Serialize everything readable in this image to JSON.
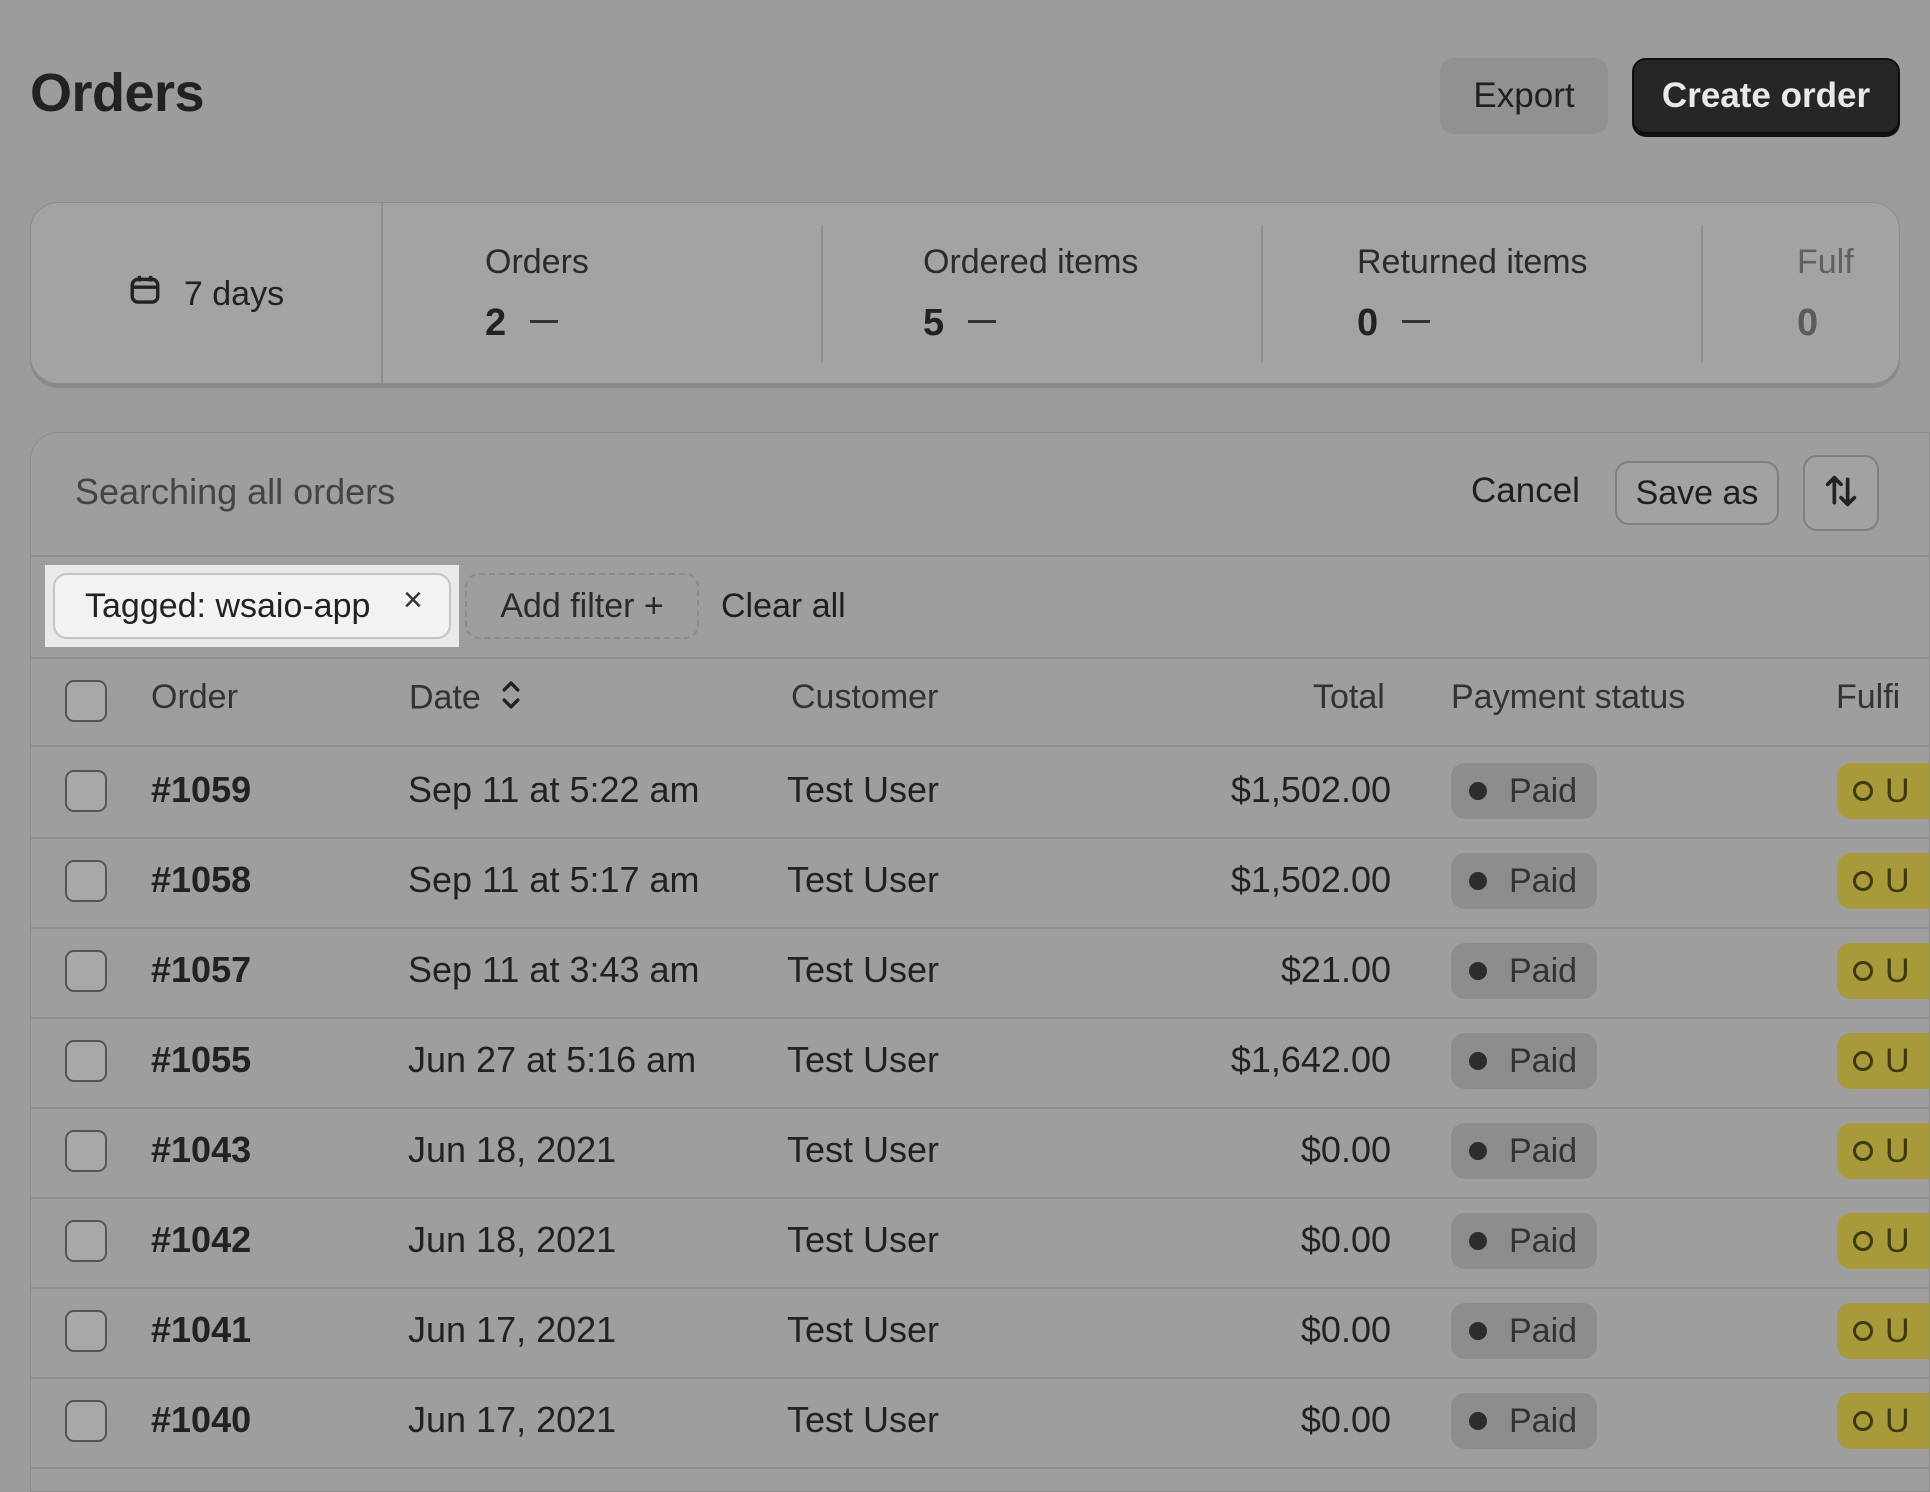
{
  "header": {
    "title": "Orders",
    "export_label": "Export",
    "create_label": "Create order"
  },
  "stats": {
    "period": "7 days",
    "items": [
      {
        "label": "Orders",
        "value": "2"
      },
      {
        "label": "Ordered items",
        "value": "5"
      },
      {
        "label": "Returned items",
        "value": "0"
      },
      {
        "label": "Fulf",
        "value": "0"
      }
    ]
  },
  "search": {
    "placeholder": "Searching all orders",
    "cancel_label": "Cancel",
    "save_as_label": "Save as"
  },
  "filters": {
    "tag_label": "Tagged: wsaio-app",
    "tag_remove": "×",
    "add_filter_label": "Add filter +",
    "clear_all_label": "Clear all"
  },
  "table": {
    "columns": {
      "order": "Order",
      "date": "Date",
      "customer": "Customer",
      "total": "Total",
      "payment_status": "Payment status",
      "fulfillment": "Fulfi"
    },
    "rows": [
      {
        "order": "#1059",
        "date": "Sep 11 at 5:22 am",
        "customer": "Test User",
        "total": "$1,502.00",
        "payment": "Paid",
        "fulfillment": "U"
      },
      {
        "order": "#1058",
        "date": "Sep 11 at 5:17 am",
        "customer": "Test User",
        "total": "$1,502.00",
        "payment": "Paid",
        "fulfillment": "U"
      },
      {
        "order": "#1057",
        "date": "Sep 11 at 3:43 am",
        "customer": "Test User",
        "total": "$21.00",
        "payment": "Paid",
        "fulfillment": "U"
      },
      {
        "order": "#1055",
        "date": "Jun 27 at 5:16 am",
        "customer": "Test User",
        "total": "$1,642.00",
        "payment": "Paid",
        "fulfillment": "U"
      },
      {
        "order": "#1043",
        "date": "Jun 18, 2021",
        "customer": "Test User",
        "total": "$0.00",
        "payment": "Paid",
        "fulfillment": "U"
      },
      {
        "order": "#1042",
        "date": "Jun 18, 2021",
        "customer": "Test User",
        "total": "$0.00",
        "payment": "Paid",
        "fulfillment": "U"
      },
      {
        "order": "#1041",
        "date": "Jun 17, 2021",
        "customer": "Test User",
        "total": "$0.00",
        "payment": "Paid",
        "fulfillment": "U"
      },
      {
        "order": "#1040",
        "date": "Jun 17, 2021",
        "customer": "Test User",
        "total": "$0.00",
        "payment": "Paid",
        "fulfillment": "U"
      }
    ]
  },
  "icons": {
    "calendar": "calendar-icon",
    "sort": "sort-icon",
    "date_sort": "chevron-up-down-icon",
    "close": "close-icon",
    "plus": "plus-icon"
  },
  "colors": {
    "background": "#9c9c9c",
    "create_button": "#262626",
    "paid_badge": "#8d8d8d",
    "fulfillment_badge": "#a89a3b",
    "highlight": "#eaeaea"
  }
}
